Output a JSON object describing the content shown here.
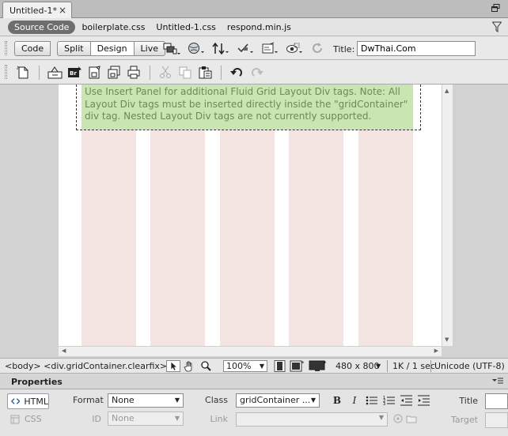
{
  "doc_tab": {
    "title": "Untitled-1*",
    "close": "×"
  },
  "related_files": {
    "source_code": "Source Code",
    "files": [
      "boilerplate.css",
      "Untitled-1.css",
      "respond.min.js"
    ]
  },
  "doc_toolbar": {
    "views": [
      "Code",
      "Split",
      "Design",
      "Live"
    ],
    "active_view": "Design",
    "title_label": "Title:",
    "title_value": "DwThai.Com"
  },
  "design_view": {
    "note": "Use Insert Panel for additional Fluid Grid Layout Div tags. Note: All Layout Div tags must be inserted directly inside the \"gridContainer\" div tag. Nested Layout Div tags are not currently supported.",
    "colors": {
      "column": "#f3e4e2",
      "div_bg": "#c9e6b2",
      "div_text": "#6a8a5a"
    }
  },
  "status_bar": {
    "tag_selector": "<body> <div.gridContainer.clearfix>",
    "zoom": "100%",
    "dimensions": "480 x 800",
    "download": "1K / 1 sec",
    "encoding": "Unicode (UTF-8)"
  },
  "properties": {
    "title": "Properties",
    "html_btn": "HTML",
    "css_btn": "CSS",
    "format_label": "Format",
    "format_value": "None",
    "id_label": "ID",
    "id_value": "None",
    "class_label": "Class",
    "class_value": "gridContainer ...",
    "link_label": "Link",
    "title_label": "Title",
    "target_label": "Target",
    "bold": "B",
    "italic": "I"
  }
}
